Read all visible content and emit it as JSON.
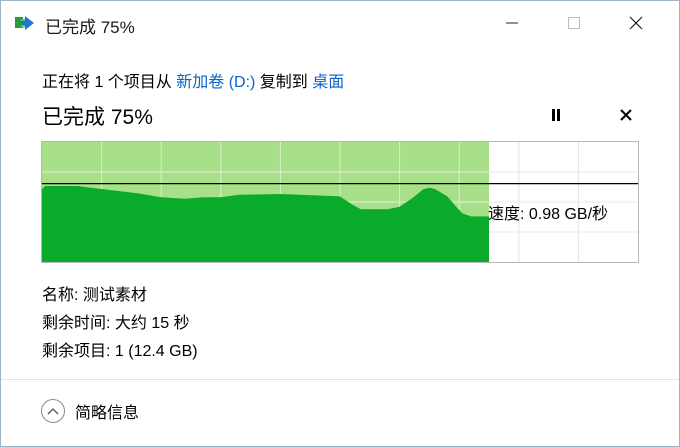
{
  "window": {
    "title": "已完成 75%",
    "controls": {
      "minimize": "minimize",
      "maximize": "maximize",
      "close": "close"
    }
  },
  "status": {
    "prefix": "正在将 1 个项目从 ",
    "source": "新加卷 (D:)",
    "middle": " 复制到 ",
    "destination": "桌面"
  },
  "progress": {
    "heading": "已完成 75%",
    "percent": 75,
    "speed_label": "速度: 0.98 GB/秒"
  },
  "chart_data": {
    "type": "area",
    "x_range": [
      0,
      100
    ],
    "progress_percent": 75,
    "speed_history": [
      [
        0,
        0.91
      ],
      [
        0.5,
        0.95
      ],
      [
        6,
        0.95
      ],
      [
        8,
        0.93
      ],
      [
        16,
        0.86
      ],
      [
        20,
        0.81
      ],
      [
        24,
        0.79
      ],
      [
        27,
        0.81
      ],
      [
        30,
        0.81
      ],
      [
        33,
        0.84
      ],
      [
        40,
        0.85
      ],
      [
        47,
        0.83
      ],
      [
        50,
        0.82
      ],
      [
        52,
        0.72
      ],
      [
        53.5,
        0.66
      ],
      [
        58,
        0.66
      ],
      [
        60,
        0.69
      ],
      [
        62,
        0.79
      ],
      [
        64,
        0.91
      ],
      [
        65,
        0.93
      ],
      [
        66,
        0.91
      ],
      [
        68,
        0.82
      ],
      [
        69.5,
        0.69
      ],
      [
        70.5,
        0.61
      ],
      [
        72,
        0.57
      ],
      [
        75,
        0.57
      ]
    ],
    "current_speed": 0.98,
    "colors": {
      "past_fill": "#a8e08a",
      "history_fill": "#0aab2a",
      "speed_line": "#000000",
      "grid": "#ffffff"
    }
  },
  "details": {
    "name_label": "名称: 测试素材",
    "time_label": "剩余时间: 大约 15 秒",
    "items_label": "剩余项目: 1 (12.4 GB)"
  },
  "footer": {
    "toggle_label": "简略信息"
  }
}
